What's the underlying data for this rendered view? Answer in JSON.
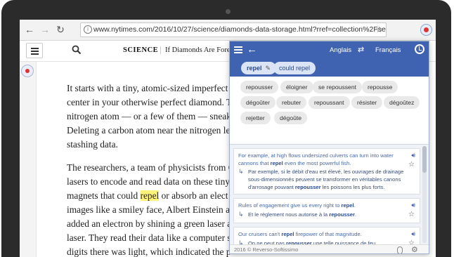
{
  "browser": {
    "back_icon": "arrow-left",
    "forward_icon": "arrow-right",
    "reload_icon": "reload",
    "url": "www.nytimes.com/2016/10/27/science/diamonds-data-storage.html?rref=collection%2Fsect"
  },
  "nyt": {
    "section": "SCIENCE",
    "headline": "If Diamonds Are Forever,"
  },
  "article": {
    "para1": [
      "It starts with a tiny, atomic-sized imperfect",
      "center in your otherwise perfect diamond. T",
      "nitrogen atom — or a few of them — sneak i",
      "Deleting a carbon atom near the nitrogen le",
      "stashing data."
    ],
    "para2_line1": "The researchers, a team of physicists from C",
    "para2_line2": "lasers to encode and read data on these tiny",
    "para2_line3_before": "magnets that could ",
    "para2_highlight": "repel",
    "para2_line3_after": " or absorb an elect",
    "para2_rest": [
      "images like a smiley face, Albert Einstein an",
      "added an electron by shining a green laser a",
      "laser. They read their data like a computer s",
      "digits there was light, which indicated the p"
    ]
  },
  "popup": {
    "source_lang": "Anglais",
    "target_lang": "Français",
    "query": "repel",
    "query_alt": "could repel",
    "synonyms": [
      "repousser",
      "éloigner",
      "se repoussent",
      "repousse",
      "dégoûter",
      "rebuter",
      "repoussant",
      "résister",
      "dégoûtez",
      "rejetter",
      "dégoûte"
    ],
    "examples": [
      {
        "en_before": "For example, at high flows undersized culverts can turn into water cannons that ",
        "en_key": "repel",
        "en_after": " even the most powerful fish.",
        "fr_before": "Par exemple, si le débit d'eau est élevé, les ouvrages de drainage sous-dimensionnés peuvent se transformer en véritables canons d'arrosage pouvant ",
        "fr_key": "repousser",
        "fr_after": " les poissons les plus forts."
      },
      {
        "en_before": "Rules of engagement give us every right to ",
        "en_key": "repel",
        "en_after": ".",
        "fr_before": "Et le règlement nous autorise à la ",
        "fr_key": "repousser",
        "fr_after": "."
      },
      {
        "en_before": "Our cruisers can't ",
        "en_key": "repel",
        "en_after": " firepower of that magnitude.",
        "fr_before": "On ne peut pas ",
        "fr_key": "repousser",
        "fr_after": " une telle puissance de feu."
      }
    ],
    "footer": "2016 © Reverso-Softissimo"
  }
}
